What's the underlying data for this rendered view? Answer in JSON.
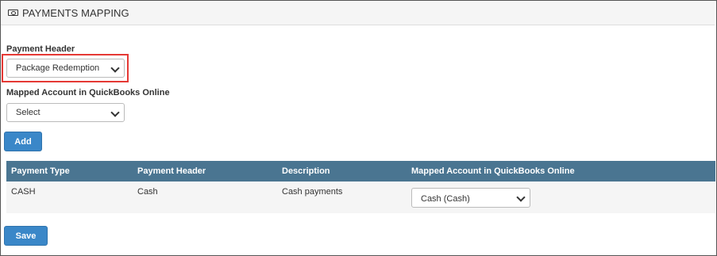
{
  "panel": {
    "title": "PAYMENTS MAPPING",
    "icon": "money-icon"
  },
  "form": {
    "payment_header_label": "Payment Header",
    "payment_header_value": "Package Redemption",
    "mapped_account_label": "Mapped Account in QuickBooks Online",
    "mapped_account_value": "Select",
    "add_label": "Add"
  },
  "table": {
    "columns": [
      "Payment Type",
      "Payment Header",
      "Description",
      "Mapped Account in QuickBooks Online"
    ],
    "rows": [
      {
        "payment_type": "CASH",
        "payment_header": "Cash",
        "description": "Cash payments",
        "mapped_account": "Cash (Cash)"
      }
    ],
    "header_color": "#4a7591"
  },
  "footer": {
    "save_label": "Save"
  },
  "colors": {
    "accent": "#3a87c8",
    "highlight": "#e53935"
  }
}
